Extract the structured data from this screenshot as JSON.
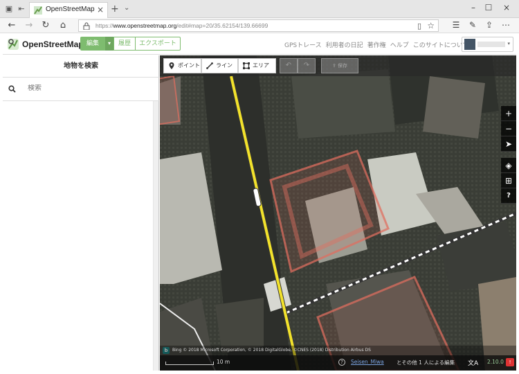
{
  "browser": {
    "tab_title": "OpenStreetMap",
    "url_prefix": "https://",
    "url_domain": "www.openstreetmap.org",
    "url_path": "/edit#map=20/35.62154/139.66699"
  },
  "header": {
    "brand": "OpenStreetMap",
    "edit_label": "編集",
    "history_label": "履歴",
    "export_label": "エクスポート",
    "links": [
      "GPSトレース",
      "利用者の日記",
      "著作権",
      "ヘルプ",
      "このサイトについて"
    ]
  },
  "sidebar": {
    "title": "地物を検索",
    "search_placeholder": "検索"
  },
  "map": {
    "modes": {
      "point": "ポイント",
      "line": "ライン",
      "area": "エリア"
    },
    "save_label": "保存",
    "zoom_in": "+",
    "zoom_out": "−",
    "attribution": "Bing  © 2018 Microsoft Corporation, © 2018 DigitalGlobe, ©CNES (2018) Distribution Airbus DS",
    "scale": "10 m",
    "contributor": "Seisen_Miwa",
    "contributors_suffix": "とその他 1 人による編集",
    "version": "2.10.0",
    "colors": {
      "road": "#f2e22c",
      "building_outline": "#e06e5f",
      "railway": "#ffffff"
    }
  }
}
